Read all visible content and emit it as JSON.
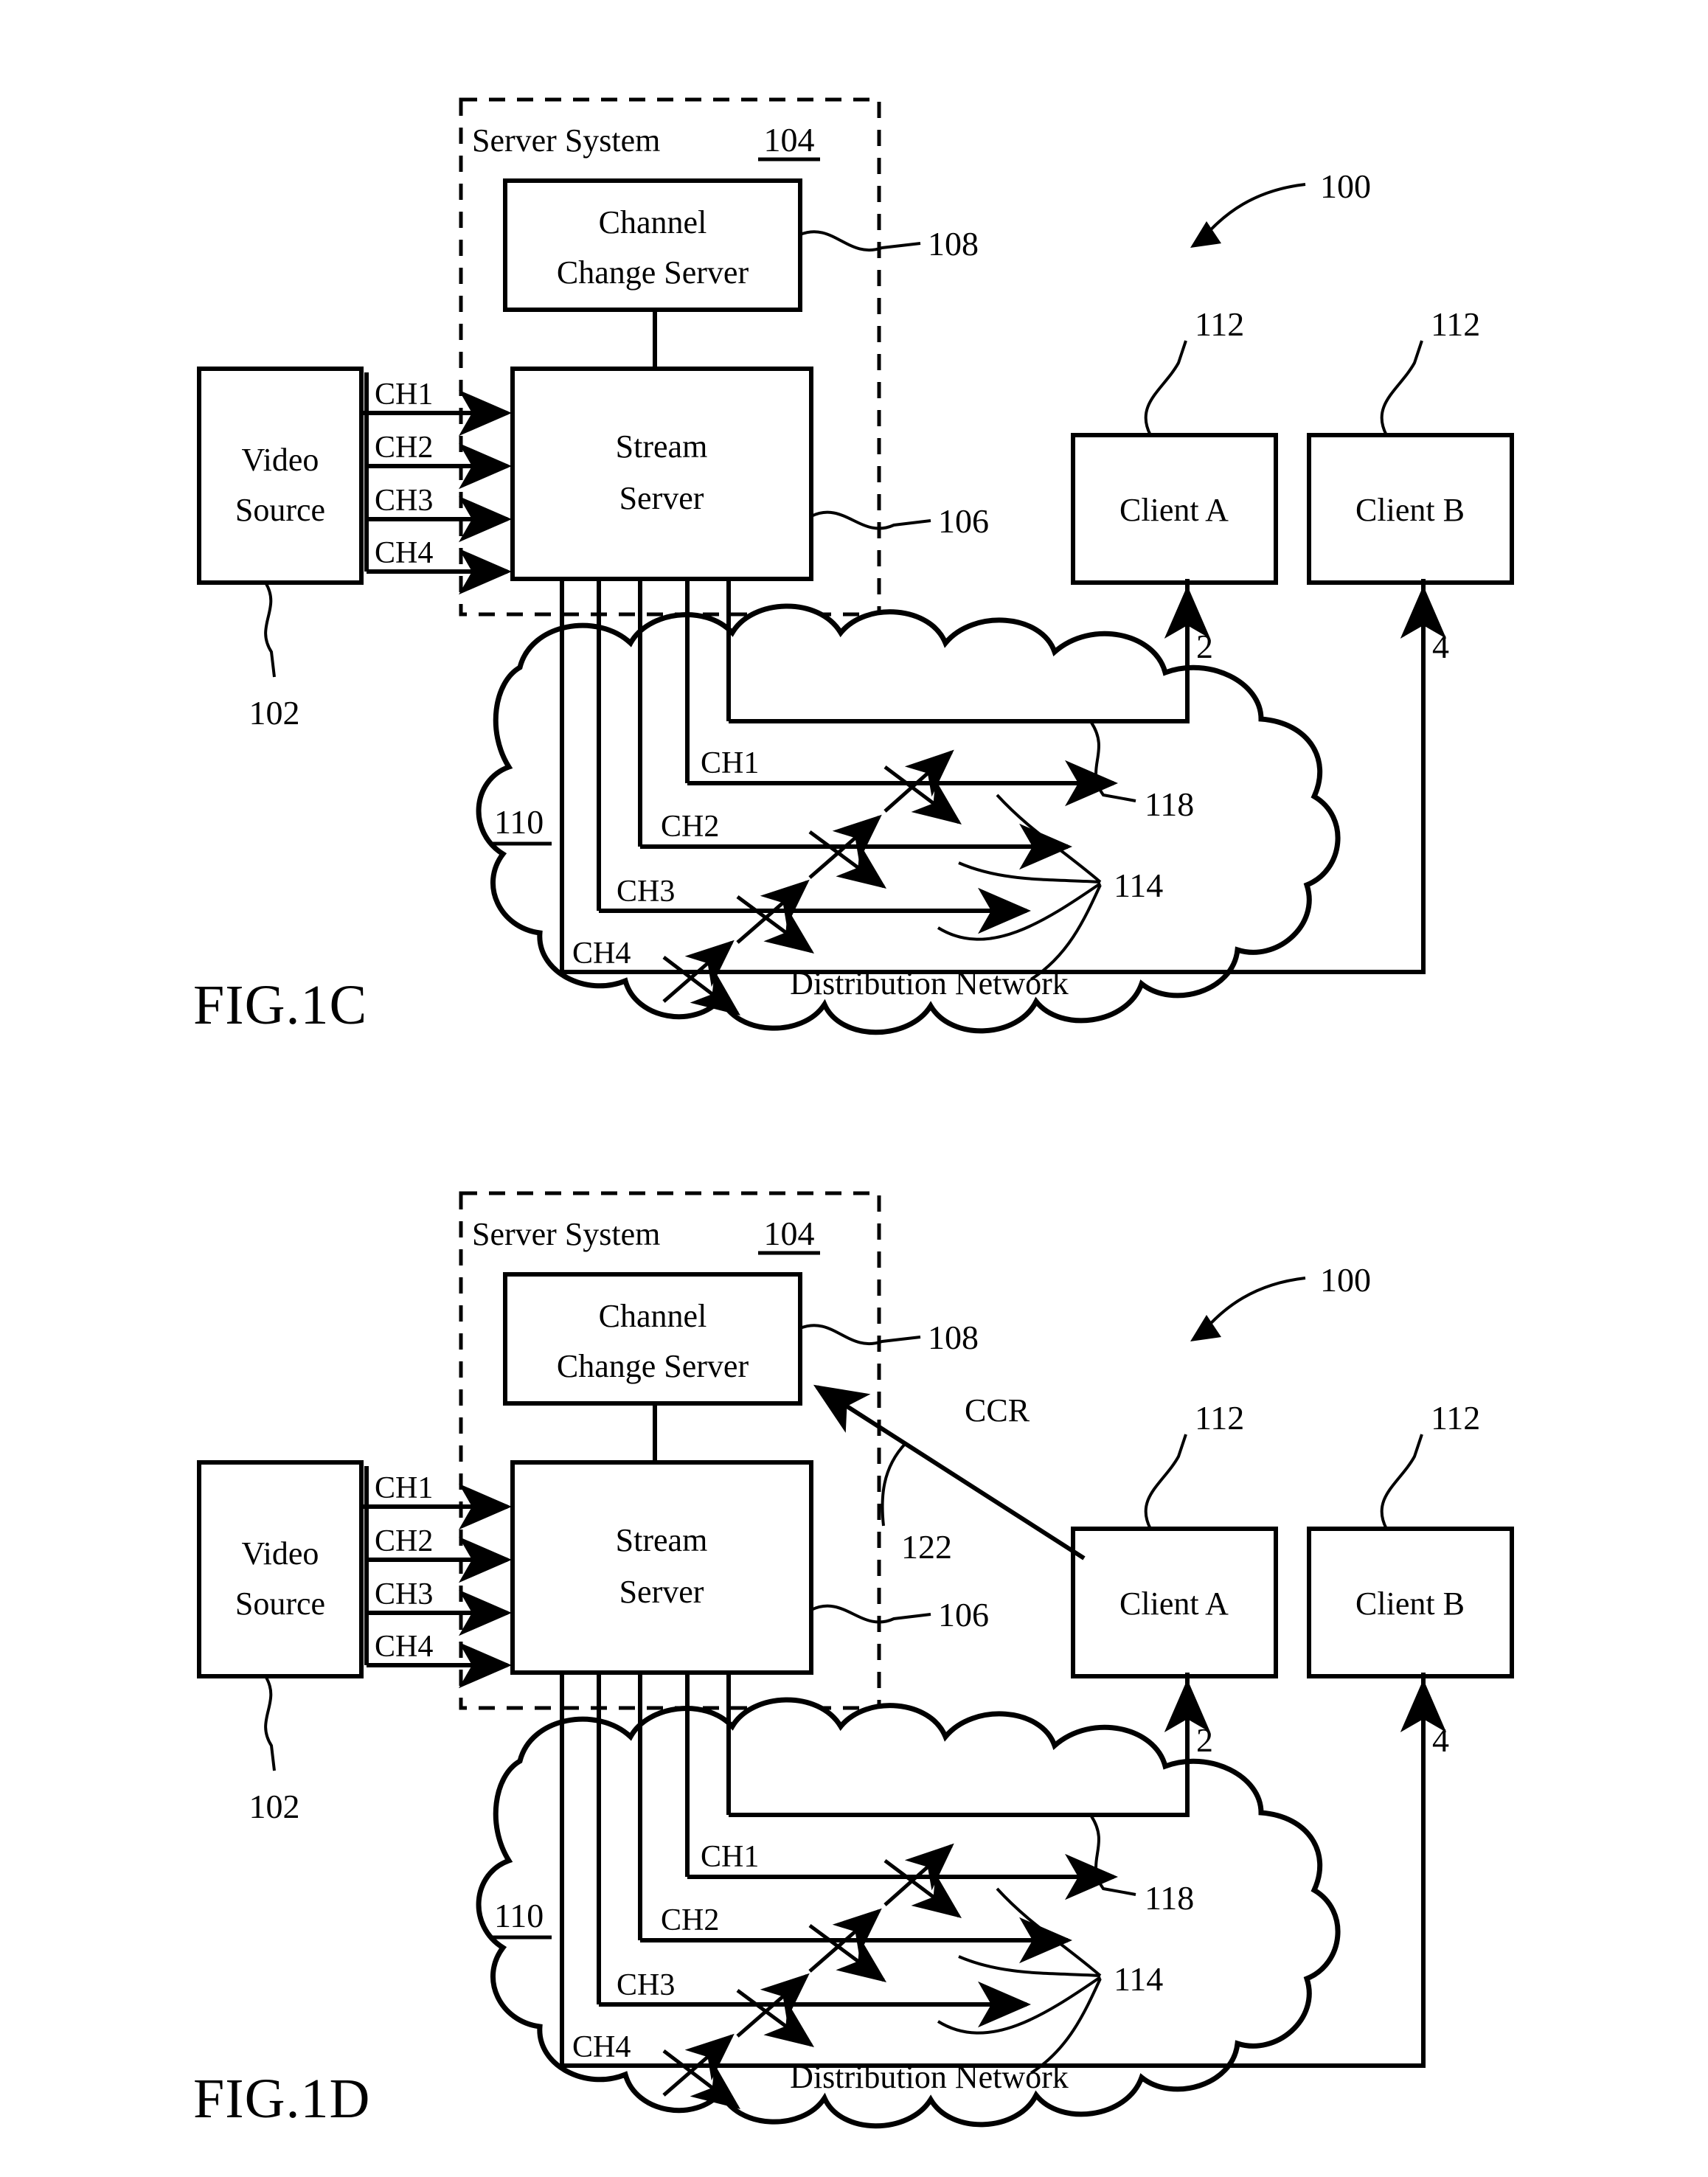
{
  "figures": [
    {
      "id": "fig-1c",
      "caption": "FIG.1C",
      "system_ref": "100",
      "server_system": {
        "title": "Server System",
        "ref": "104",
        "channel_change_server": {
          "line1": "Channel",
          "line2": "Change Server",
          "ref": "108"
        },
        "stream_server": {
          "line1": "Stream",
          "line2": "Server",
          "ref": "106"
        }
      },
      "video_source": {
        "line1": "Video",
        "line2": "Source",
        "ref": "102"
      },
      "input_channels": [
        "CH1",
        "CH2",
        "CH3",
        "CH4"
      ],
      "network": {
        "label": "Distribution Network",
        "ref": "110",
        "channels": [
          "CH1",
          "CH2",
          "CH3",
          "CH4"
        ],
        "unicast_ref": "118",
        "multicast_ref": "114"
      },
      "clients": [
        {
          "label": "Client A",
          "ref": "112",
          "stream_number": "2"
        },
        {
          "label": "Client B",
          "ref": "112",
          "stream_number": "4"
        }
      ],
      "ccr": null,
      "ccr_ref": null
    },
    {
      "id": "fig-1d",
      "caption": "FIG.1D",
      "system_ref": "100",
      "server_system": {
        "title": "Server System",
        "ref": "104",
        "channel_change_server": {
          "line1": "Channel",
          "line2": "Change Server",
          "ref": "108"
        },
        "stream_server": {
          "line1": "Stream",
          "line2": "Server",
          "ref": "106"
        }
      },
      "video_source": {
        "line1": "Video",
        "line2": "Source",
        "ref": "102"
      },
      "input_channels": [
        "CH1",
        "CH2",
        "CH3",
        "CH4"
      ],
      "network": {
        "label": "Distribution Network",
        "ref": "110",
        "channels": [
          "CH1",
          "CH2",
          "CH3",
          "CH4"
        ],
        "unicast_ref": "118",
        "multicast_ref": "114"
      },
      "clients": [
        {
          "label": "Client A",
          "ref": "112",
          "stream_number": "2"
        },
        {
          "label": "Client B",
          "ref": "112",
          "stream_number": "4"
        }
      ],
      "ccr": "CCR",
      "ccr_ref": "122"
    }
  ],
  "colors": {
    "ink": "#000000",
    "paper": "#ffffff"
  }
}
